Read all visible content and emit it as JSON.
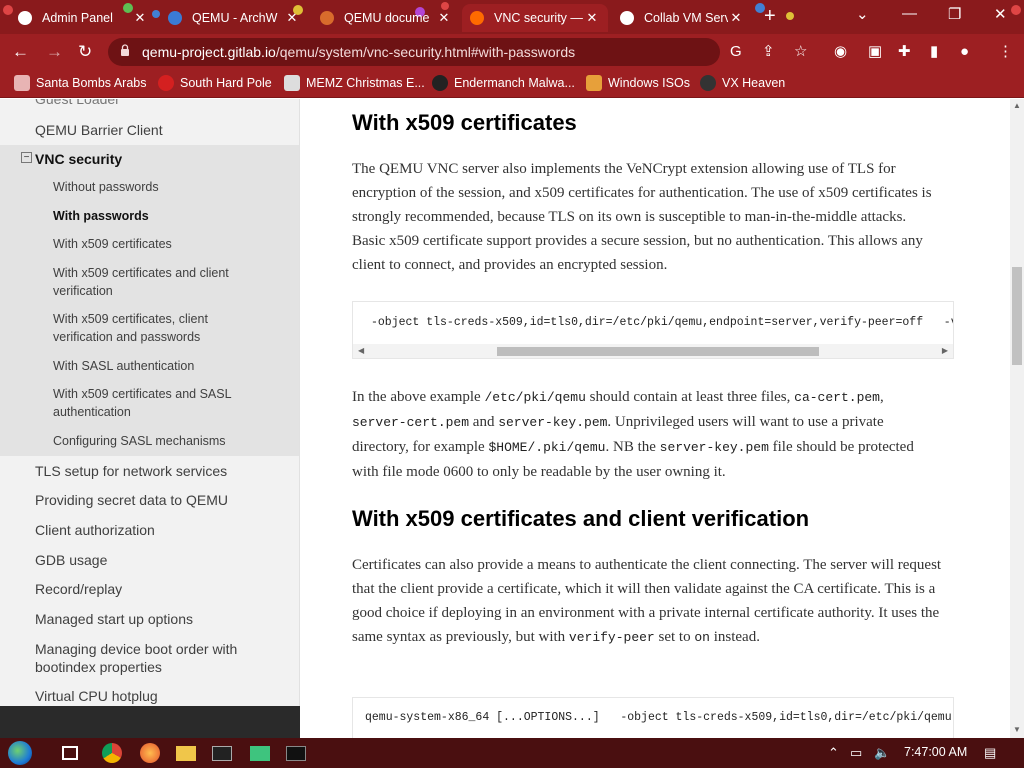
{
  "browser": {
    "tabs": [
      {
        "label": "Admin Panel",
        "active": false,
        "favicon_color": "#ffffff"
      },
      {
        "label": "QEMU - ArchW",
        "active": false,
        "favicon_color": "#3a7bd5"
      },
      {
        "label": "QEMU docume",
        "active": false,
        "favicon_color": "#d86b2c"
      },
      {
        "label": "VNC security —",
        "active": true,
        "favicon_color": "#ff6a00"
      },
      {
        "label": "Collab VM Serv",
        "active": false,
        "favicon_color": "#ffffff"
      }
    ],
    "url_host": "qemu-project.gitlab.io",
    "url_path": "/qemu/system/vnc-security.html#with-passwords",
    "bookmarks": [
      {
        "label": "Santa Bombs Arabs",
        "icon_color": "#e8b4b4"
      },
      {
        "label": "South Hard Pole",
        "icon_color": "#d42020"
      },
      {
        "label": "MEMZ Christmas E...",
        "icon_color": "#dddddd"
      },
      {
        "label": "Endermanch Malwa...",
        "icon_color": "#222222"
      },
      {
        "label": "Windows ISOs",
        "icon_color": "#e7a03a"
      },
      {
        "label": "VX Heaven",
        "icon_color": "#333333"
      }
    ],
    "accent": "#9d1f22"
  },
  "sidebar": {
    "top_partial": "Guest Loader",
    "barrier": "QEMU Barrier Client",
    "vnc": "VNC security",
    "sub": [
      "Without passwords",
      "With passwords",
      "With x509 certificates",
      "With x509 certificates and client verification",
      "With x509 certificates, client verification and passwords",
      "With SASL authentication",
      "With x509 certificates and SASL authentication",
      "Configuring SASL mechanisms"
    ],
    "items": [
      "TLS setup for network services",
      "Providing secret data to QEMU",
      "Client authorization",
      "GDB usage",
      "Record/replay",
      "Managed start up options",
      "Managing device boot order with bootindex properties",
      "Virtual CPU hotplug"
    ]
  },
  "content": {
    "h1": "With x509 certificates",
    "p1": "The QEMU VNC server also implements the VeNCrypt extension allowing use of TLS for encryption of the session, and x509 certificates for authentication. The use of x509 certificates is strongly recommended, because TLS on its own is susceptible to man-in-the-middle attacks. Basic x509 certificate support provides a secure session, but no authentication. This allows any client to connect, and provides an encrypted session.",
    "code1": "-object tls-creds-x509,id=tls0,dir=/etc/pki/qemu,endpoint=server,verify-peer=off   -vnc",
    "p2": {
      "a": "In the above example ",
      "c1": "/etc/pki/qemu",
      "b": " should contain at least three files, ",
      "c2": "ca-cert.pem",
      "c": ", ",
      "c3": "server-cert.pem",
      "d": " and ",
      "c4": "server-key.pem",
      "e": ". Unprivileged users will want to use a private directory, for example ",
      "c5": "$HOME/.pki/qemu",
      "f": ". NB the ",
      "c6": "server-key.pem",
      "g": " file should be protected with file mode 0600 to only be readable by the user owning it."
    },
    "h2": "With x509 certificates and client verification",
    "p3": {
      "a": "Certificates can also provide a means to authenticate the client connecting. The server will request that the client provide a certificate, which it will then validate against the CA certificate. This is a good choice if deploying in an environment with a private internal certificate authority. It uses the same syntax as previously, but with ",
      "c1": "verify-peer",
      "b": " set to ",
      "c2": "on",
      "c": " instead."
    },
    "code2": "qemu-system-x86_64 [...OPTIONS...]   -object tls-creds-x509,id=tls0,dir=/etc/pki/qemu,endpoint"
  },
  "taskbar": {
    "clock": "7:47:00 AM"
  }
}
